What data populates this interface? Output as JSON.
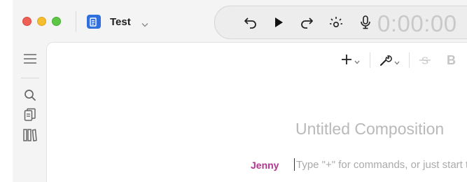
{
  "window": {
    "traffic_lights": [
      "close",
      "minimize",
      "zoom"
    ],
    "colors": {
      "close": "#ee5f56",
      "minimize": "#f5bd30",
      "zoom": "#5dc644"
    }
  },
  "document": {
    "title": "Test",
    "icon": "document-icon",
    "icon_color": "#2f6fde"
  },
  "transport": {
    "buttons": [
      "undo-icon",
      "play-icon",
      "redo-icon",
      "ai-sparkle-icon",
      "microphone-icon"
    ],
    "timecode": "0:00:00"
  },
  "left_rail": {
    "items": [
      "menu-icon",
      "search-icon",
      "documents-icon",
      "library-icon"
    ]
  },
  "toolbar": {
    "insert": "plus-icon",
    "tools": "wrench-icon",
    "strikethrough": "strikethrough-icon",
    "bold_label": "B"
  },
  "editor": {
    "composition_title": "Untitled Composition",
    "speaker": "Jenny",
    "speaker_color": "#b4358f",
    "placeholder": "Type \"+\" for commands, or just start typing"
  }
}
